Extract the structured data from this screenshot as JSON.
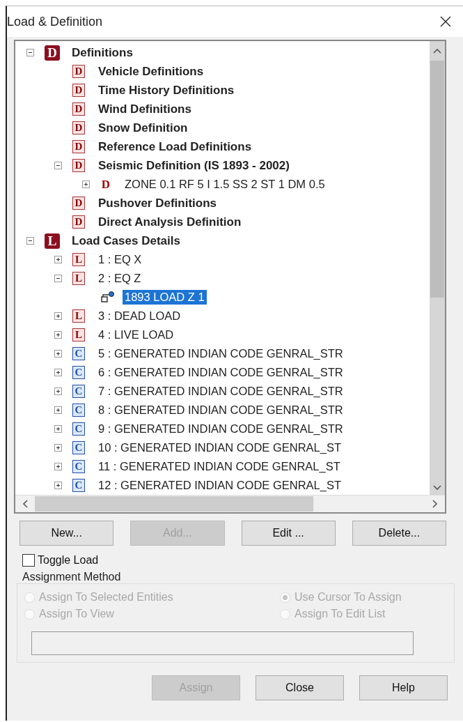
{
  "window": {
    "title": "Load & Definition"
  },
  "tree": [
    {
      "kind": "group",
      "badge": "D",
      "label": "Definitions",
      "expanded": true,
      "selected": false,
      "children": [
        {
          "kind": "definition",
          "badge": "D",
          "label": "Vehicle Definitions",
          "selected": false
        },
        {
          "kind": "definition",
          "badge": "D",
          "label": "Time History Definitions",
          "selected": false
        },
        {
          "kind": "definition",
          "badge": "D",
          "label": "Wind Definitions",
          "selected": false
        },
        {
          "kind": "definition",
          "badge": "D",
          "label": "Snow Definition",
          "selected": false
        },
        {
          "kind": "definition",
          "badge": "D",
          "label": "Reference Load Definitions",
          "selected": false
        },
        {
          "kind": "definition",
          "badge": "D",
          "label": "Seismic Definition (IS 1893 - 2002)",
          "expanded": true,
          "selected": false,
          "children": [
            {
              "kind": "zone",
              "badge": "D",
              "label": "ZONE 0.1 RF 5 I 1.5 SS 2 ST 1 DM 0.5",
              "expanded": false,
              "selected": false
            }
          ]
        },
        {
          "kind": "definition",
          "badge": "D",
          "label": "Pushover Definitions",
          "selected": false
        },
        {
          "kind": "definition",
          "badge": "D",
          "label": "Direct Analysis Definition",
          "selected": false
        }
      ]
    },
    {
      "kind": "group",
      "badge": "L",
      "label": "Load Cases Details",
      "expanded": true,
      "selected": false,
      "children": [
        {
          "kind": "load",
          "badge": "L",
          "label": "1 : EQ X",
          "expanded": false,
          "selected": false
        },
        {
          "kind": "load",
          "badge": "L",
          "label": "2 : EQ Z",
          "expanded": true,
          "selected": false,
          "children": [
            {
              "kind": "load-item",
              "label": "1893 LOAD Z 1",
              "selected": true
            }
          ]
        },
        {
          "kind": "load",
          "badge": "L",
          "label": "3 : DEAD LOAD",
          "expanded": false,
          "selected": false
        },
        {
          "kind": "load",
          "badge": "L",
          "label": "4 : LIVE LOAD",
          "expanded": false,
          "selected": false
        },
        {
          "kind": "combination",
          "badge": "C",
          "label": "5 : GENERATED INDIAN CODE GENRAL_STR",
          "expanded": false,
          "selected": false
        },
        {
          "kind": "combination",
          "badge": "C",
          "label": "6 : GENERATED INDIAN CODE GENRAL_STR",
          "expanded": false,
          "selected": false
        },
        {
          "kind": "combination",
          "badge": "C",
          "label": "7 : GENERATED INDIAN CODE GENRAL_STR",
          "expanded": false,
          "selected": false
        },
        {
          "kind": "combination",
          "badge": "C",
          "label": "8 : GENERATED INDIAN CODE GENRAL_STR",
          "expanded": false,
          "selected": false
        },
        {
          "kind": "combination",
          "badge": "C",
          "label": "9 : GENERATED INDIAN CODE GENRAL_STR",
          "expanded": false,
          "selected": false
        },
        {
          "kind": "combination",
          "badge": "C",
          "label": "10 : GENERATED INDIAN CODE GENRAL_ST",
          "expanded": false,
          "selected": false
        },
        {
          "kind": "combination",
          "badge": "C",
          "label": "11 : GENERATED INDIAN CODE GENRAL_ST",
          "expanded": false,
          "selected": false
        },
        {
          "kind": "combination",
          "badge": "C",
          "label": "12 : GENERATED INDIAN CODE GENRAL_ST",
          "expanded": false,
          "selected": false
        }
      ]
    }
  ],
  "buttons": [
    {
      "label": "New...",
      "disabled": false
    },
    {
      "label": "Add...",
      "disabled": true
    },
    {
      "label": "Edit ...",
      "disabled": false
    },
    {
      "label": "Delete...",
      "disabled": false
    }
  ],
  "toggle_load": {
    "label": "Toggle Load",
    "checked": false
  },
  "assignment_method": {
    "title": "Assignment Method",
    "options": [
      {
        "label": "Assign To Selected Entities",
        "selected": false,
        "disabled": true
      },
      {
        "label": "Use Cursor To Assign",
        "selected": true,
        "disabled": true
      },
      {
        "label": "Assign To View",
        "selected": false,
        "disabled": true
      },
      {
        "label": "Assign To Edit List",
        "selected": false,
        "disabled": true
      }
    ]
  },
  "footer_buttons": [
    {
      "label": "Assign",
      "disabled": true
    },
    {
      "label": "Close",
      "disabled": false
    },
    {
      "label": "Help",
      "disabled": false
    }
  ]
}
